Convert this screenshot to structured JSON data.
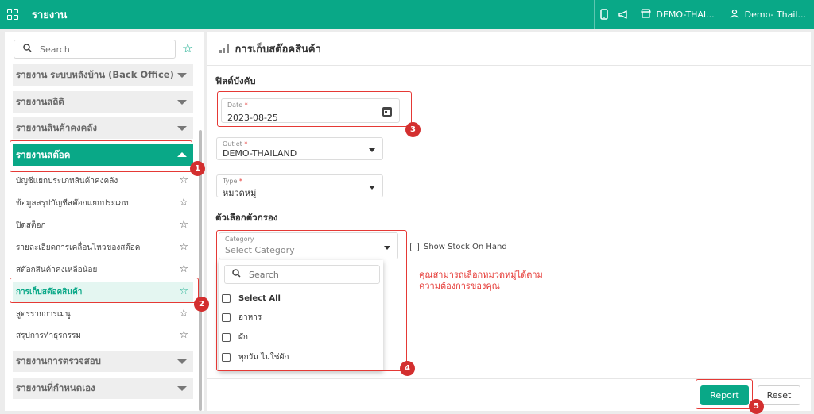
{
  "topbar": {
    "title": "รายงาน",
    "outlet": "DEMO-THAI...",
    "user": "Demo- Thail..."
  },
  "sidebar": {
    "search_placeholder": "Search",
    "groups": [
      {
        "label": "รายงาน ระบบหลังบ้าน (Back Office)"
      },
      {
        "label": "รายงานสถิติ"
      },
      {
        "label": "รายงานสินค้าคงคลัง"
      },
      {
        "label": "รายงานสต๊อค"
      },
      {
        "label": "รายงานการตรวจสอบ"
      },
      {
        "label": "รายงานที่กำหนดเอง"
      }
    ],
    "items": [
      {
        "label": "บัญชีแยกประเภทสินค้าคงคลัง"
      },
      {
        "label": "ข้อมูลสรุปบัญชีสต๊อกแยกประเภท"
      },
      {
        "label": "ปิดสต็อก"
      },
      {
        "label": "รายละเอียดการเคลื่อนไหวของสต๊อค"
      },
      {
        "label": "สต๊อกสินค้าคงเหลือน้อย"
      },
      {
        "label": "การเก็บสต๊อคสินค้า"
      },
      {
        "label": "สูตรรายการเมนู"
      },
      {
        "label": "สรุปการทำธุรกรรม"
      }
    ]
  },
  "main": {
    "title": "การเก็บสต๊อคสินค้า",
    "section_required": "ฟิลด์บังคับ",
    "date": {
      "label": "Date",
      "value": "2023-08-25"
    },
    "outlet": {
      "label": "Outlet",
      "value": "DEMO-THAILAND"
    },
    "type": {
      "label": "Type",
      "value": "หมวดหมู่"
    },
    "section_filter": "ตัวเลือกตัวกรอง",
    "category": {
      "label": "Category",
      "placeholder": "Select Category"
    },
    "dropdown": {
      "search_placeholder": "Search",
      "options": [
        {
          "label": "Select All"
        },
        {
          "label": "อาหาร"
        },
        {
          "label": "ผัก"
        },
        {
          "label": "ทุกวัน ไม่ใช่ผัก"
        }
      ]
    },
    "show_stock_label": "Show Stock On Hand",
    "note_line1": "คุณสามารถเลือกหมวดหมู่ได้ตาม",
    "note_line2": "ความต้องการของคุณ",
    "report_label": "Report",
    "reset_label": "Reset"
  },
  "annotations": {
    "badges": [
      "1",
      "2",
      "3",
      "4",
      "5"
    ],
    "color": "#e53935"
  },
  "colors": {
    "brand": "#09a887"
  }
}
